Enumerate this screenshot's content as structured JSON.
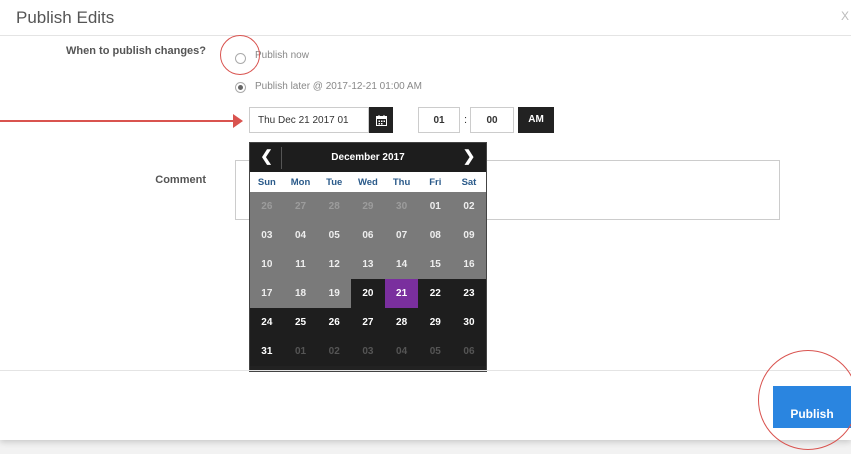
{
  "dialog": {
    "title": "Publish Edits",
    "close": "X"
  },
  "form": {
    "when_label": "When to publish changes?",
    "option_now": "Publish now",
    "option_later": "Publish later @ 2017-12-21 01:00 AM",
    "selected_option": "later",
    "date_value": "Thu Dec 21 2017 01",
    "hour": "01",
    "colon": ":",
    "minute": "00",
    "ampm": "AM",
    "comment_label": "Comment",
    "comment_value": ""
  },
  "calendar": {
    "month": "December 2017",
    "prev": "❮",
    "next": "❯",
    "weekdays": [
      "Sun",
      "Mon",
      "Tue",
      "Wed",
      "Thu",
      "Fri",
      "Sat"
    ],
    "selected_day": "21",
    "weeks": [
      [
        {
          "d": "26",
          "o": true
        },
        {
          "d": "27",
          "o": true
        },
        {
          "d": "28",
          "o": true
        },
        {
          "d": "29",
          "o": true
        },
        {
          "d": "30",
          "o": true
        },
        {
          "d": "01"
        },
        {
          "d": "02"
        }
      ],
      [
        {
          "d": "03"
        },
        {
          "d": "04"
        },
        {
          "d": "05"
        },
        {
          "d": "06"
        },
        {
          "d": "07"
        },
        {
          "d": "08"
        },
        {
          "d": "09"
        }
      ],
      [
        {
          "d": "10"
        },
        {
          "d": "11"
        },
        {
          "d": "12"
        },
        {
          "d": "13"
        },
        {
          "d": "14"
        },
        {
          "d": "15"
        },
        {
          "d": "16"
        }
      ],
      [
        {
          "d": "17"
        },
        {
          "d": "18"
        },
        {
          "d": "19"
        },
        {
          "d": "20",
          "f": true
        },
        {
          "d": "21",
          "f": true
        },
        {
          "d": "22",
          "f": true
        },
        {
          "d": "23",
          "f": true
        }
      ],
      [
        {
          "d": "24",
          "f": true
        },
        {
          "d": "25",
          "f": true
        },
        {
          "d": "26",
          "f": true
        },
        {
          "d": "27",
          "f": true
        },
        {
          "d": "28",
          "f": true
        },
        {
          "d": "29",
          "f": true
        },
        {
          "d": "30",
          "f": true
        }
      ],
      [
        {
          "d": "31",
          "f": true
        },
        {
          "d": "01",
          "f": true,
          "o": true
        },
        {
          "d": "02",
          "f": true,
          "o": true
        },
        {
          "d": "03",
          "f": true,
          "o": true
        },
        {
          "d": "04",
          "f": true,
          "o": true
        },
        {
          "d": "05",
          "f": true,
          "o": true
        },
        {
          "d": "06",
          "f": true,
          "o": true
        }
      ]
    ]
  },
  "footer": {
    "publish_label": "Publish"
  },
  "colors": {
    "accent": "#2a85e0",
    "selected_day": "#7a2f9e",
    "annotation": "#d9534f"
  }
}
